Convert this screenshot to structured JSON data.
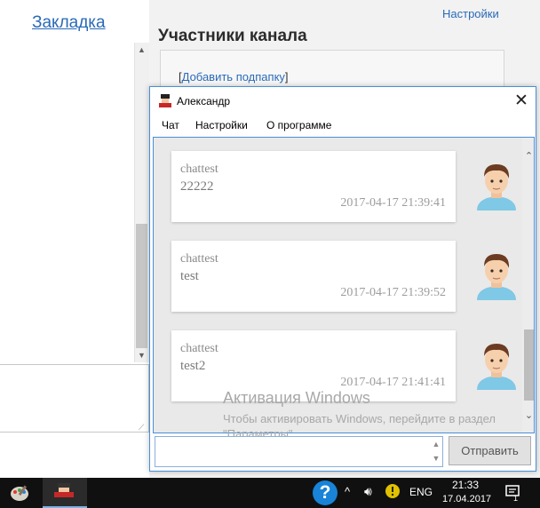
{
  "background": {
    "bookmark_link": "Закладка",
    "settings_link": "Настройки",
    "members_title": "Участники канала",
    "add_subfolder": {
      "open": "[",
      "link": "Добавить подпапку",
      "close": "]"
    }
  },
  "window": {
    "title": "Александр",
    "close": "✕",
    "menu": [
      "Чат",
      "Настройки",
      "О программе"
    ]
  },
  "messages": [
    {
      "user": "chattest",
      "text": "22222",
      "time": "2017-04-17 21:39:41"
    },
    {
      "user": "chattest",
      "text": "test",
      "time": "2017-04-17 21:39:52"
    },
    {
      "user": "chattest",
      "text": "test2",
      "time": "2017-04-17 21:41:41"
    }
  ],
  "activation": {
    "title": "Активация Windows",
    "text": "Чтобы активировать Windows, перейдите в раздел \"Параметры\"."
  },
  "composer": {
    "value": "",
    "send_label": "Отправить"
  },
  "taskbar": {
    "help": "?",
    "chevron": "^",
    "language": "ENG",
    "time": "21:33",
    "date": "17.04.2017",
    "notification_count": "1"
  },
  "colors": {
    "accent": "#4b8ed6",
    "link": "#2a6ab8",
    "taskbar": "#101010"
  }
}
